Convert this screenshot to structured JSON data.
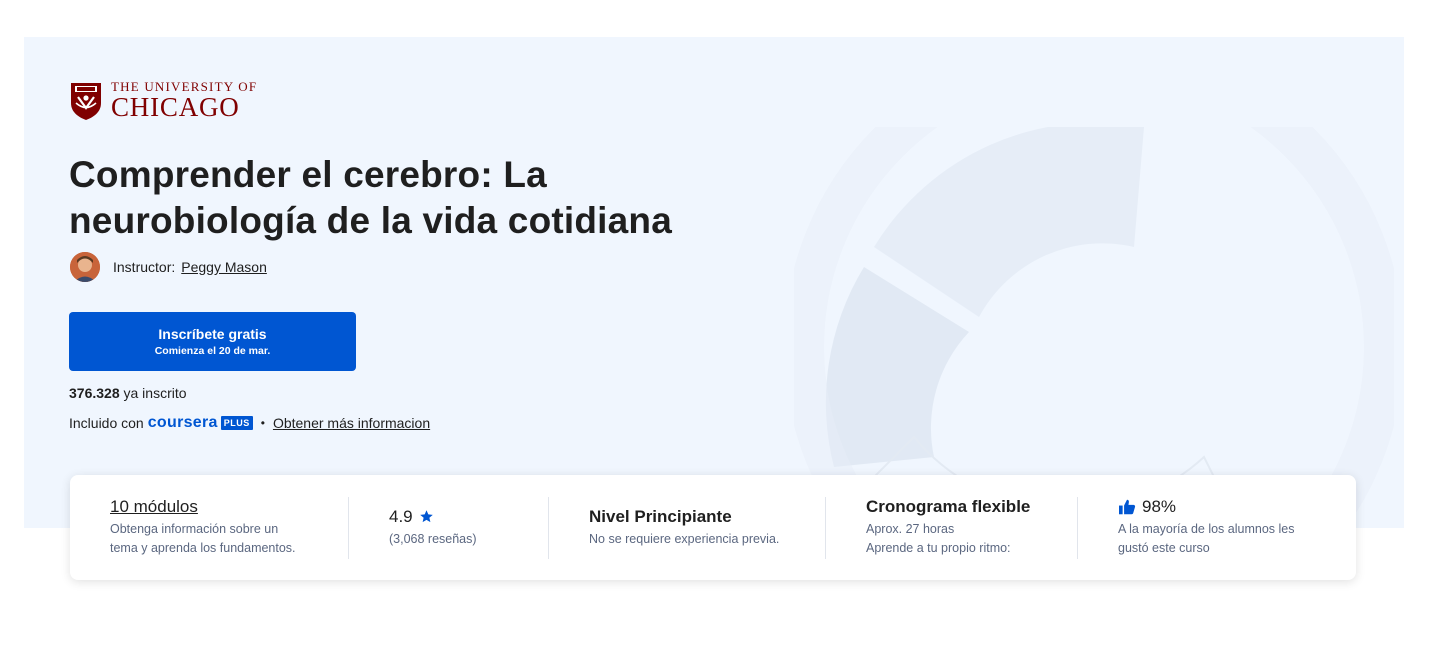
{
  "logo": {
    "line1": "THE UNIVERSITY OF",
    "line2": "CHICAGO",
    "crest_icon": "university-crest-icon",
    "color": "#800000"
  },
  "course": {
    "title": "Comprender el cerebro: La neurobiología de la vida cotidiana"
  },
  "instructor": {
    "label": "Instructor:",
    "name": "Peggy Mason"
  },
  "enroll": {
    "label": "Inscríbete gratis",
    "start": "Comienza el 20 de mar."
  },
  "enrollment": {
    "count": "376.328",
    "suffix": "ya inscrito"
  },
  "included": {
    "label": "Incluido con",
    "brand": "coursera",
    "badge": "PLUS",
    "separator": "•",
    "more_link": "Obtener más informacion"
  },
  "stats": {
    "modules": {
      "title": "10 módulos",
      "desc_line1": "Obtenga información sobre un",
      "desc_line2": "tema y aprenda los fundamentos."
    },
    "rating": {
      "value": "4.9",
      "reviews": "(3,068 reseñas)",
      "icon": "star-icon"
    },
    "level": {
      "title": "Nivel Principiante",
      "desc": "No se requiere experiencia previa."
    },
    "schedule": {
      "title": "Cronograma flexible",
      "desc_line1": "Aprox. 27 horas",
      "desc_line2": "Aprende a tu propio ritmo:"
    },
    "satisfaction": {
      "value": "98%",
      "desc_line1": "A la mayoría de los alumnos les",
      "desc_line2": "gustó este curso",
      "icon": "thumbs-up-icon"
    }
  },
  "colors": {
    "primary": "#0056d2",
    "hero_bg": "#f0f6fe",
    "text": "#1f1f1f",
    "muted": "#5b6780"
  }
}
